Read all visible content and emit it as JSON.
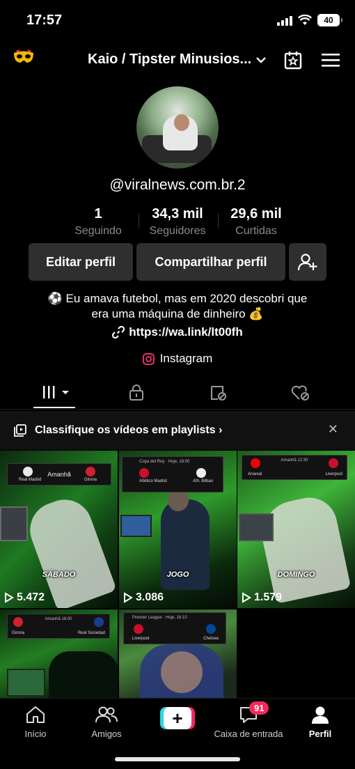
{
  "status": {
    "time": "17:57",
    "battery": "40"
  },
  "header": {
    "title": "Kaio / Tipster Minusios..."
  },
  "profile": {
    "username": "@viralnews.com.br.2",
    "stats": [
      {
        "value": "1",
        "label": "Seguindo"
      },
      {
        "value": "34,3 mil",
        "label": "Seguidores"
      },
      {
        "value": "29,6 mil",
        "label": "Curtidas"
      }
    ],
    "edit_label": "Editar perfil",
    "share_label": "Compartilhar perfil",
    "bio_line1": "⚽ Eu amava futebol, mas em 2020 descobri que",
    "bio_line2": "era uma máquina de dinheiro 💰",
    "link": "https://wa.link/lt00fh",
    "instagram": "Instagram"
  },
  "playlist_banner": {
    "text": "Classifique os vídeos em playlists",
    "chevron": "›"
  },
  "videos": [
    {
      "caption": "SÁBADO",
      "views": "5.472",
      "home": "Real Madrid",
      "away": "Girona",
      "mid": "Amanhã"
    },
    {
      "caption": "JOGO",
      "views": "3.086",
      "home": "Atlético Madrid",
      "away": "Ath. Bilbao",
      "mid": "Copa del Rey · Hoje, 16:00"
    },
    {
      "caption": "DOMINGO",
      "views": "1.579",
      "home": "Arsenal",
      "away": "Liverpool",
      "mid": "Amanhã 12:30"
    },
    {
      "caption": "",
      "views": "",
      "home": "Girona",
      "away": "Real Sociedad",
      "mid": "Amanhã 16:00"
    },
    {
      "caption": "",
      "views": "",
      "home": "Liverpool",
      "away": "Chelsea",
      "mid": "Premier League · Hoje, 16:10"
    }
  ],
  "nav": {
    "home": "Início",
    "friends": "Amigos",
    "inbox": "Caixa de entrada",
    "inbox_badge": "91",
    "profile": "Perfil"
  },
  "colors": {
    "accent_pink": "#f2295b",
    "accent_cyan": "#29d6e8",
    "insta": "#e1306c"
  }
}
